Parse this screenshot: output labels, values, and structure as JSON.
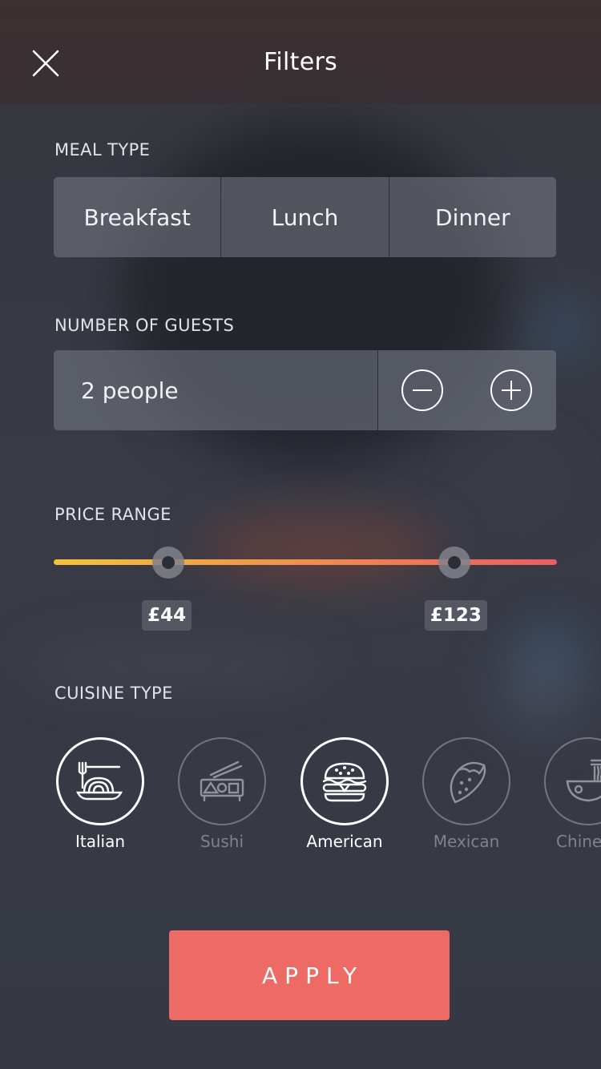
{
  "header": {
    "title": "Filters"
  },
  "meal_type": {
    "label": "MEAL TYPE",
    "options": [
      {
        "label": "Breakfast"
      },
      {
        "label": "Lunch"
      },
      {
        "label": "Dinner"
      }
    ]
  },
  "guests": {
    "label": "NUMBER OF GUESTS",
    "value": "2 people"
  },
  "price_range": {
    "label": "PRICE RANGE",
    "min_label": "£44",
    "max_label": "£123",
    "min_fraction": 0.228,
    "max_fraction": 0.796
  },
  "cuisine": {
    "label": "CUISINE TYPE",
    "items": [
      {
        "label": "Italian",
        "icon": "noodles-icon",
        "selected": true
      },
      {
        "label": "Sushi",
        "icon": "sushi-icon",
        "selected": false
      },
      {
        "label": "American",
        "icon": "burger-icon",
        "selected": true
      },
      {
        "label": "Mexican",
        "icon": "taco-icon",
        "selected": false
      },
      {
        "label": "Chinese",
        "icon": "ramen-bowl-icon",
        "selected": false
      }
    ]
  },
  "actions": {
    "apply_label": "APPLY"
  },
  "colors": {
    "accent": "#ee6a64",
    "slider_start": "#f3c43a",
    "slider_end": "#ea5d60"
  }
}
